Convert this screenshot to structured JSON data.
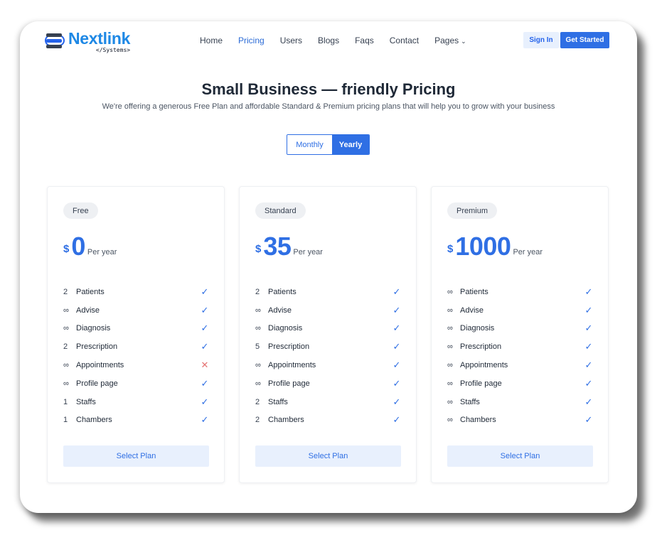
{
  "brand": {
    "name": "Nextlink",
    "tagline": "</Systems>"
  },
  "nav": {
    "items": [
      "Home",
      "Pricing",
      "Users",
      "Blogs",
      "Faqs",
      "Contact",
      "Pages"
    ],
    "active": "Pricing",
    "pages_chevron": "⌄"
  },
  "auth": {
    "signin": "Sign In",
    "get_started": "Get Started"
  },
  "hero": {
    "title": "Small Business — friendly Pricing",
    "subtitle": "We're offering a generous Free Plan and affordable Standard & Premium pricing plans that will help you to grow with your business"
  },
  "billing_toggle": {
    "monthly": "Monthly",
    "yearly": "Yearly",
    "selected": "Yearly"
  },
  "colors": {
    "accent": "#2f6fe4",
    "light_accent": "#e8f0fd",
    "cross": "#e57373"
  },
  "plans": [
    {
      "name": "Free",
      "currency": "$",
      "amount": "0",
      "period": "Per year",
      "features": [
        {
          "qty": "2",
          "name": "Patients",
          "included": "✓"
        },
        {
          "qty": "∞",
          "name": "Advise",
          "included": "✓"
        },
        {
          "qty": "∞",
          "name": "Diagnosis",
          "included": "✓"
        },
        {
          "qty": "2",
          "name": "Prescription",
          "included": "✓"
        },
        {
          "qty": "∞",
          "name": "Appointments",
          "included": "✕"
        },
        {
          "qty": "∞",
          "name": "Profile page",
          "included": "✓"
        },
        {
          "qty": "1",
          "name": "Staffs",
          "included": "✓"
        },
        {
          "qty": "1",
          "name": "Chambers",
          "included": "✓"
        }
      ],
      "cta": "Select Plan"
    },
    {
      "name": "Standard",
      "currency": "$",
      "amount": "35",
      "period": "Per year",
      "features": [
        {
          "qty": "2",
          "name": "Patients",
          "included": "✓"
        },
        {
          "qty": "∞",
          "name": "Advise",
          "included": "✓"
        },
        {
          "qty": "∞",
          "name": "Diagnosis",
          "included": "✓"
        },
        {
          "qty": "5",
          "name": "Prescription",
          "included": "✓"
        },
        {
          "qty": "∞",
          "name": "Appointments",
          "included": "✓"
        },
        {
          "qty": "∞",
          "name": "Profile page",
          "included": "✓"
        },
        {
          "qty": "2",
          "name": "Staffs",
          "included": "✓"
        },
        {
          "qty": "2",
          "name": "Chambers",
          "included": "✓"
        }
      ],
      "cta": "Select Plan"
    },
    {
      "name": "Premium",
      "currency": "$",
      "amount": "1000",
      "period": "Per year",
      "features": [
        {
          "qty": "∞",
          "name": "Patients",
          "included": "✓"
        },
        {
          "qty": "∞",
          "name": "Advise",
          "included": "✓"
        },
        {
          "qty": "∞",
          "name": "Diagnosis",
          "included": "✓"
        },
        {
          "qty": "∞",
          "name": "Prescription",
          "included": "✓"
        },
        {
          "qty": "∞",
          "name": "Appointments",
          "included": "✓"
        },
        {
          "qty": "∞",
          "name": "Profile page",
          "included": "✓"
        },
        {
          "qty": "∞",
          "name": "Staffs",
          "included": "✓"
        },
        {
          "qty": "∞",
          "name": "Chambers",
          "included": "✓"
        }
      ],
      "cta": "Select Plan"
    }
  ]
}
